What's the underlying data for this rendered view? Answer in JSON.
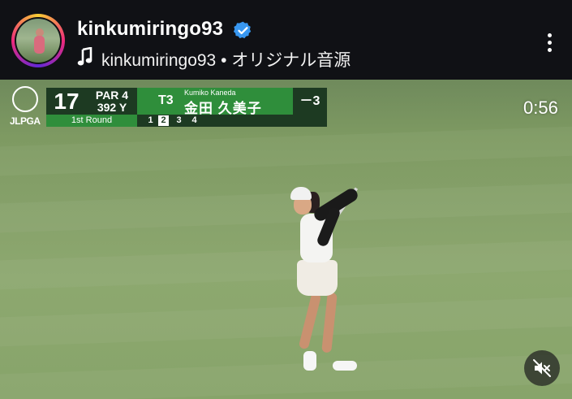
{
  "header": {
    "username": "kinkumiringo93",
    "audio_label": "kinkumiringo93 • オリジナル音源"
  },
  "video": {
    "logo_text": "JLPGA",
    "scoreboard": {
      "hole": "17",
      "par": "PAR 4",
      "yards": "392 Y",
      "position": "T3",
      "player_romaji": "Kumiko  Kaneda",
      "player_kanji": "金田 久美子",
      "score": "－3",
      "round_label": "1st Round",
      "rounds": [
        "1",
        "2",
        "3",
        "4"
      ],
      "active_round": "2"
    },
    "timer": "0:56"
  },
  "colors": {
    "header_bg": "#101115",
    "verified_blue": "#3897f0",
    "board_dark": "#1d3a22",
    "board_green": "#2f8e3b",
    "fairway": "#86a16a"
  },
  "icons": {
    "verified": "verified-badge-icon",
    "music": "music-note-icon",
    "more": "more-vertical-icon",
    "mute": "speaker-muted-icon"
  }
}
